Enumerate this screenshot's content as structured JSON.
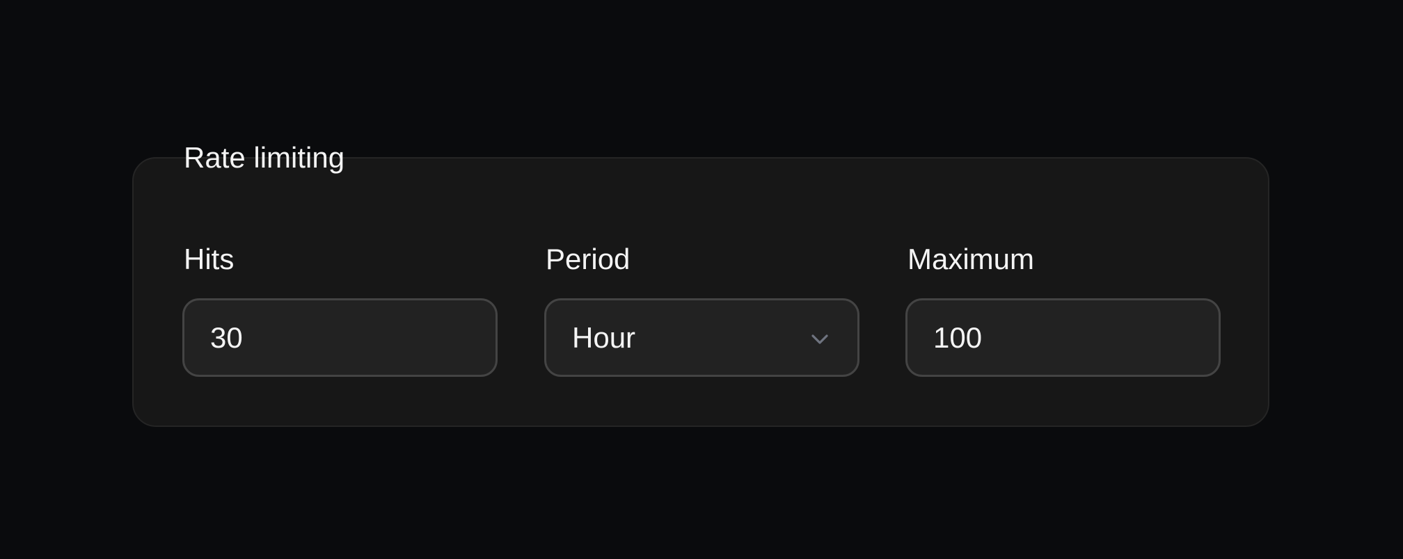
{
  "section": {
    "title": "Rate limiting"
  },
  "fields": {
    "hits": {
      "label": "Hits",
      "value": "30"
    },
    "period": {
      "label": "Period",
      "selected": "Hour",
      "icon": "chevron-down-icon"
    },
    "maximum": {
      "label": "Maximum",
      "value": "100"
    }
  },
  "colors": {
    "background": "#0a0b0d",
    "panel": "#171717",
    "panel_border": "#252525",
    "input_background": "#222222",
    "input_border": "#444444",
    "text": "#f4f4f4",
    "icon": "#6f7480"
  }
}
